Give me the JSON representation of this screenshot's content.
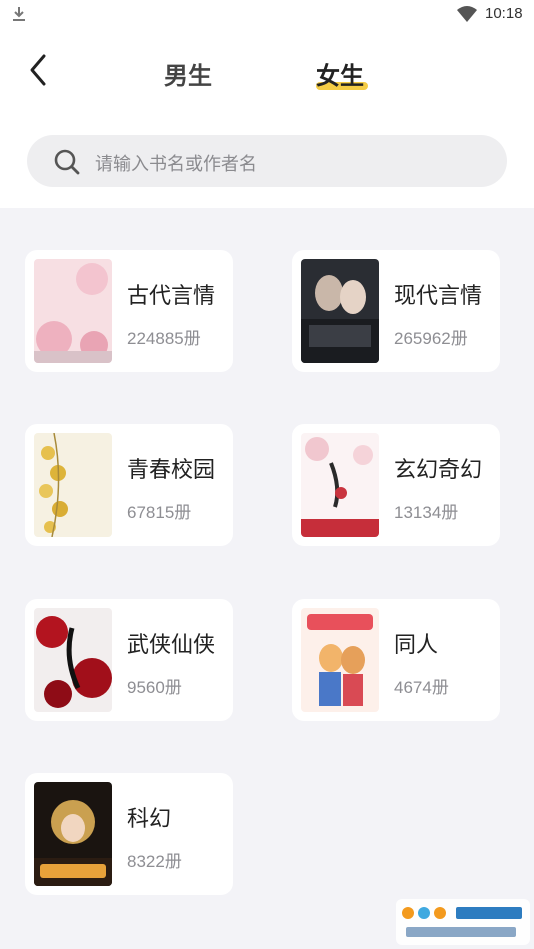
{
  "status_bar": {
    "time": "10:18"
  },
  "tabs": [
    {
      "label": "男生",
      "active": false
    },
    {
      "label": "女生",
      "active": true
    }
  ],
  "search": {
    "placeholder": "请输入书名或作者名"
  },
  "categories": [
    {
      "title": "古代言情",
      "count": "224885册"
    },
    {
      "title": "现代言情",
      "count": "265962册"
    },
    {
      "title": "青春校园",
      "count": "67815册"
    },
    {
      "title": "玄幻奇幻",
      "count": "13134册"
    },
    {
      "title": "武侠仙侠",
      "count": "9560册"
    },
    {
      "title": "同人",
      "count": "4674册"
    },
    {
      "title": "科幻",
      "count": "8322册"
    }
  ],
  "colors": {
    "accent": "#f4cc45",
    "background": "#f3f3f7"
  }
}
